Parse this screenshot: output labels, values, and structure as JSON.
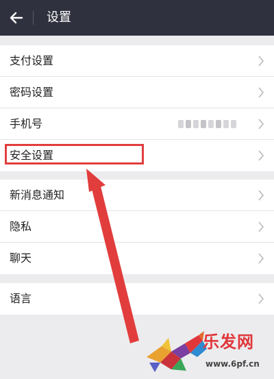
{
  "header": {
    "title": "设置",
    "back_icon": "arrow-left-icon"
  },
  "groups": [
    {
      "items": [
        {
          "label": "支付设置"
        },
        {
          "label": "密码设置"
        },
        {
          "label": "手机号",
          "value_masked": true
        },
        {
          "label": "安全设置",
          "highlighted": true
        }
      ]
    },
    {
      "items": [
        {
          "label": "新消息通知"
        },
        {
          "label": "隐私"
        },
        {
          "label": "聊天"
        }
      ]
    },
    {
      "items": [
        {
          "label": "语言"
        }
      ]
    }
  ],
  "annotation": {
    "color": "#e23d3d",
    "target": "安全设置"
  },
  "watermark": {
    "name": "乐发网",
    "url": "www.6pf.cn"
  },
  "colors": {
    "topbar": "#2f313e",
    "background": "#ececee",
    "accent": "#e23d3d"
  }
}
